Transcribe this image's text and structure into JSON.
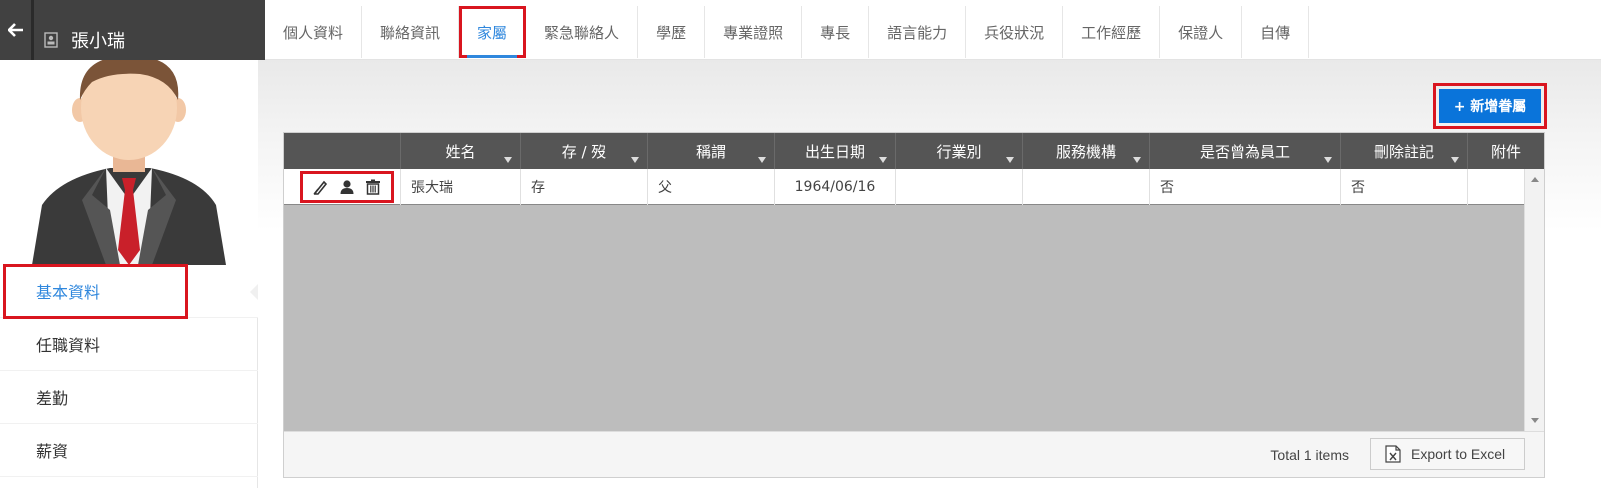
{
  "header": {
    "user_name": "張小瑞",
    "tabs": [
      {
        "label": "個人資料",
        "active": false
      },
      {
        "label": "聯絡資訊",
        "active": false
      },
      {
        "label": "家屬",
        "active": true
      },
      {
        "label": "緊急聯絡人",
        "active": false
      },
      {
        "label": "學歷",
        "active": false
      },
      {
        "label": "專業證照",
        "active": false
      },
      {
        "label": "專長",
        "active": false
      },
      {
        "label": "語言能力",
        "active": false
      },
      {
        "label": "兵役狀況",
        "active": false
      },
      {
        "label": "工作經歷",
        "active": false
      },
      {
        "label": "保證人",
        "active": false
      },
      {
        "label": "自傳",
        "active": false
      }
    ]
  },
  "sidebar": {
    "items": [
      {
        "label": "基本資料",
        "active": true
      },
      {
        "label": "任職資料",
        "active": false
      },
      {
        "label": "差勤",
        "active": false
      },
      {
        "label": "薪資",
        "active": false
      }
    ]
  },
  "toolbar": {
    "add_label": "+ 新增眷屬"
  },
  "grid": {
    "columns": [
      "",
      "姓名",
      "存 / 歿",
      "稱謂",
      "出生日期",
      "行業別",
      "服務機構",
      "是否曾為員工",
      "刪除註記",
      "附件"
    ],
    "rows": [
      {
        "name": "張大瑞",
        "status": "存",
        "relation": "父",
        "birth": "1964/06/16",
        "industry": "",
        "org": "",
        "former_employee": "否",
        "deleted": "否",
        "attachment": ""
      }
    ],
    "total": "Total 1 items",
    "export_label": "Export to Excel"
  },
  "colors": {
    "accent": "#2f87dd",
    "primary_button": "#0a74da",
    "highlight": "#d9151f",
    "header_dark": "#414141",
    "grid_header": "#555555"
  }
}
